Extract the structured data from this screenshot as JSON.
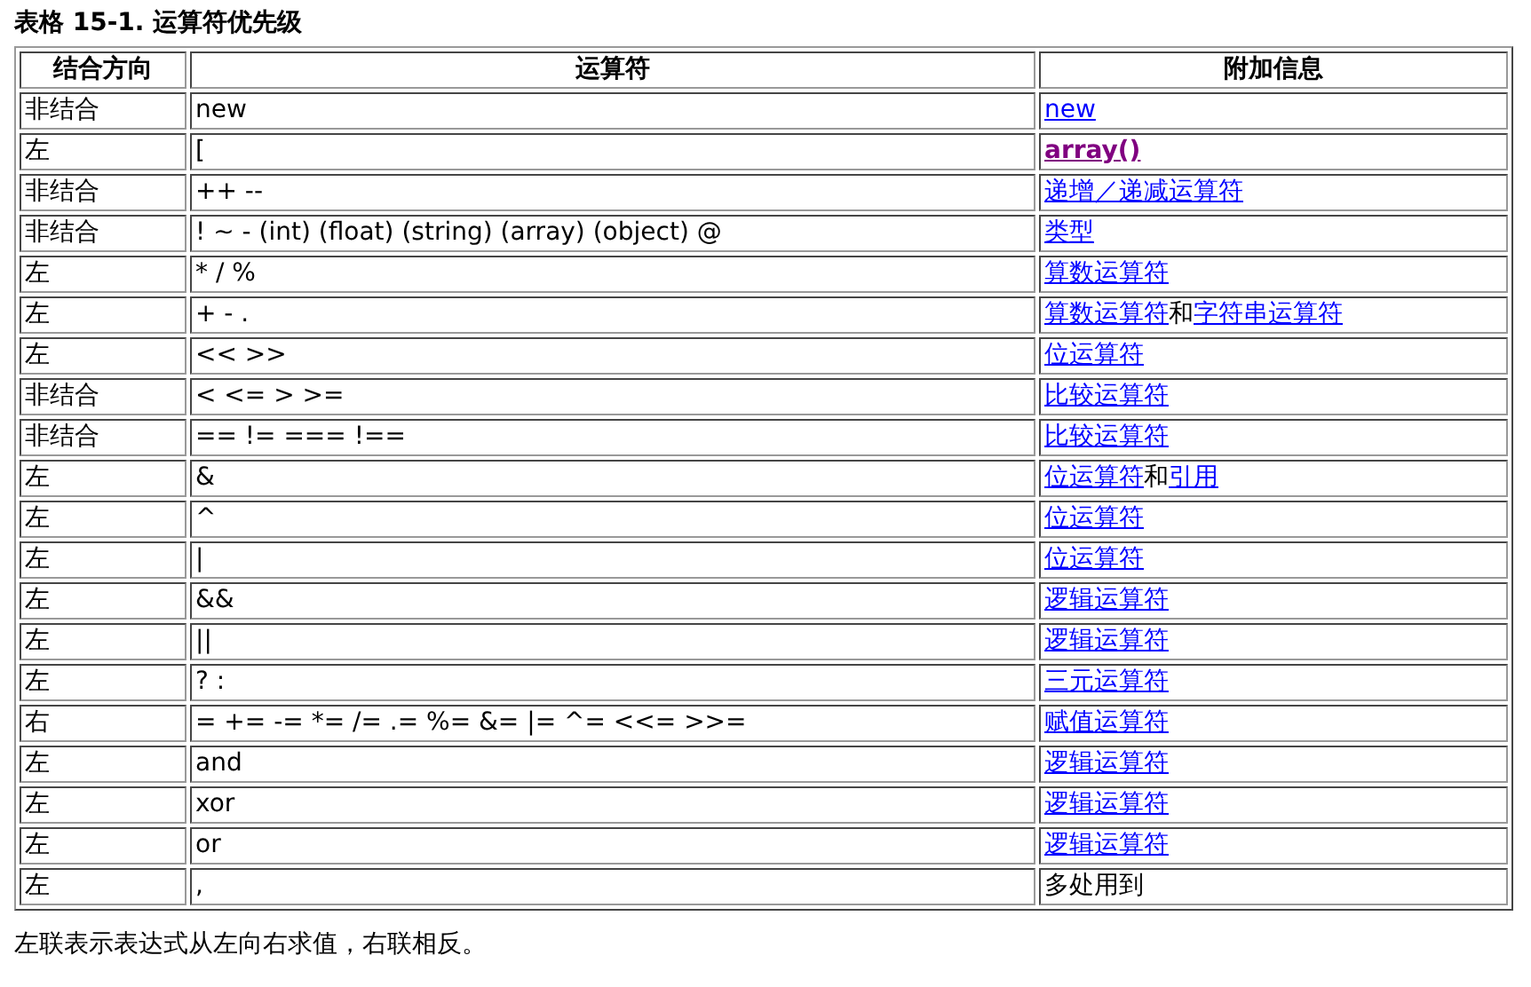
{
  "title": "表格  15-1. 运算符优先级",
  "columns": [
    "结合方向",
    "运算符",
    "附加信息"
  ],
  "rows": [
    {
      "associativity": "非结合",
      "operators": "new",
      "info": [
        {
          "kind": "link",
          "text": "new"
        }
      ]
    },
    {
      "associativity": "左",
      "operators": "[",
      "info": [
        {
          "kind": "visited_link",
          "text": "array()"
        }
      ]
    },
    {
      "associativity": "非结合",
      "operators": "++ --",
      "info": [
        {
          "kind": "link",
          "text": "递增／递减运算符"
        }
      ]
    },
    {
      "associativity": "非结合",
      "operators": "! ~ - (int) (float) (string) (array) (object) @",
      "info": [
        {
          "kind": "link",
          "text": "类型"
        }
      ]
    },
    {
      "associativity": "左",
      "operators": "* / %",
      "info": [
        {
          "kind": "link",
          "text": "算数运算符"
        }
      ]
    },
    {
      "associativity": "左",
      "operators": "+ - .",
      "info": [
        {
          "kind": "link",
          "text": "算数运算符"
        },
        {
          "kind": "plain",
          "text": "和"
        },
        {
          "kind": "link",
          "text": "字符串运算符"
        }
      ]
    },
    {
      "associativity": "左",
      "operators": "<< >>",
      "info": [
        {
          "kind": "link",
          "text": "位运算符"
        }
      ]
    },
    {
      "associativity": "非结合",
      "operators": "< <= > >=",
      "info": [
        {
          "kind": "link",
          "text": "比较运算符"
        }
      ]
    },
    {
      "associativity": "非结合",
      "operators": "== != === !==",
      "info": [
        {
          "kind": "link",
          "text": "比较运算符"
        }
      ]
    },
    {
      "associativity": "左",
      "operators": "&",
      "info": [
        {
          "kind": "link",
          "text": "位运算符"
        },
        {
          "kind": "plain",
          "text": "和"
        },
        {
          "kind": "link",
          "text": "引用"
        }
      ]
    },
    {
      "associativity": "左",
      "operators": "^",
      "info": [
        {
          "kind": "link",
          "text": "位运算符"
        }
      ]
    },
    {
      "associativity": "左",
      "operators": "|",
      "info": [
        {
          "kind": "link",
          "text": "位运算符"
        }
      ]
    },
    {
      "associativity": "左",
      "operators": "&&",
      "info": [
        {
          "kind": "link",
          "text": "逻辑运算符"
        }
      ]
    },
    {
      "associativity": "左",
      "operators": "||",
      "info": [
        {
          "kind": "link",
          "text": "逻辑运算符"
        }
      ]
    },
    {
      "associativity": "左",
      "operators": "? :",
      "info": [
        {
          "kind": "link",
          "text": "三元运算符"
        }
      ]
    },
    {
      "associativity": "右",
      "operators": "= += -= *= /= .= %= &= |= ^= <<= >>=",
      "info": [
        {
          "kind": "link",
          "text": "赋值运算符"
        }
      ]
    },
    {
      "associativity": "左",
      "operators": "and",
      "info": [
        {
          "kind": "link",
          "text": "逻辑运算符"
        }
      ]
    },
    {
      "associativity": "左",
      "operators": "xor",
      "info": [
        {
          "kind": "link",
          "text": "逻辑运算符"
        }
      ]
    },
    {
      "associativity": "左",
      "operators": "or",
      "info": [
        {
          "kind": "link",
          "text": "逻辑运算符"
        }
      ]
    },
    {
      "associativity": "左",
      "operators": ",",
      "info": [
        {
          "kind": "plain",
          "text": "多处用到"
        }
      ]
    }
  ],
  "footnote": "左联表示表达式从左向右求值，右联相反。"
}
